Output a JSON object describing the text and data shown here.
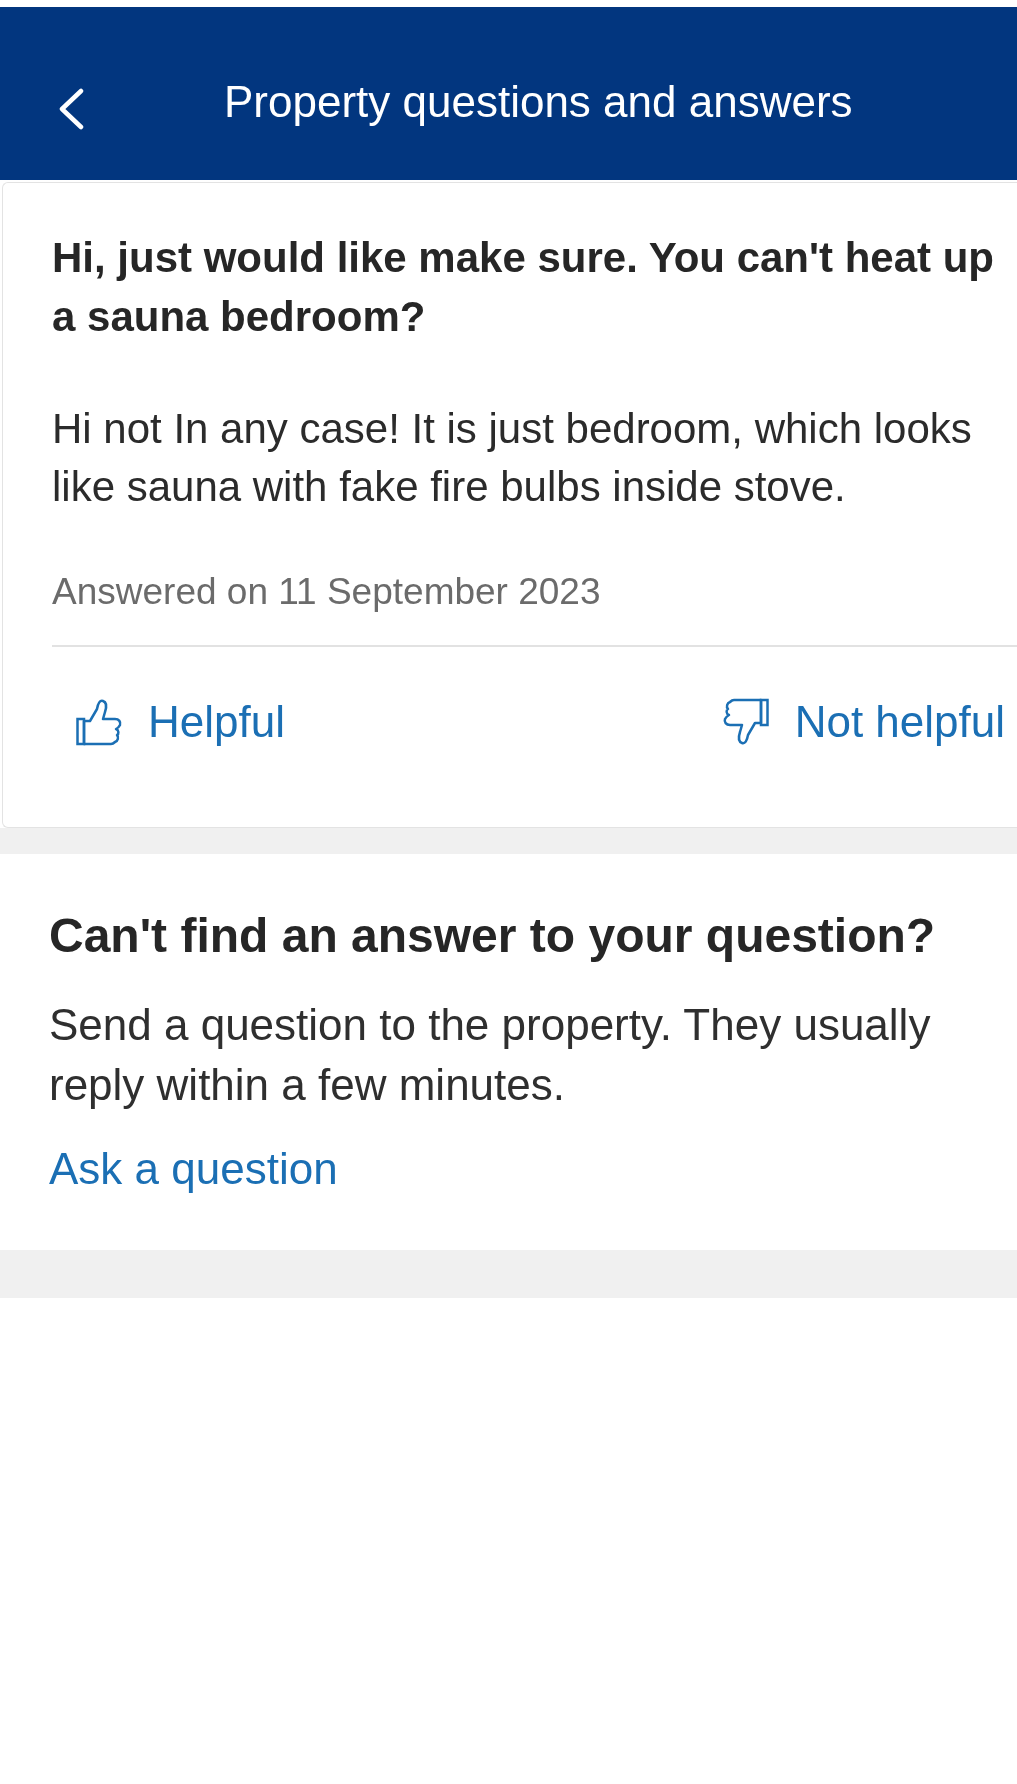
{
  "header": {
    "title": "Property questions and answers"
  },
  "qa": {
    "question": "Hi, just would like make sure. You can't heat up a sauna bedroom?",
    "answer": "Hi not In any case! It is just bedroom, which looks like sauna with fake fire bulbs inside stove.",
    "date": "Answered on 11 September 2023",
    "votes": [
      {
        "kind": "helpful",
        "label": "Helpful"
      },
      {
        "kind": "not_helpful",
        "label": "Not helpful"
      }
    ]
  },
  "ask": {
    "heading": "Can't find an answer to your question?",
    "text": "Send a question to the property. They usually reply within a few minutes.",
    "link": "Ask a question"
  }
}
